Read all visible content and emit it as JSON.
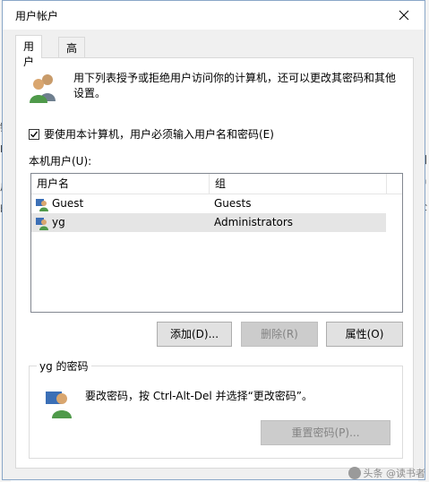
{
  "window": {
    "title": "用户帐户"
  },
  "tabs": [
    {
      "label": "用户",
      "active": true
    },
    {
      "label": "高级",
      "active": false
    }
  ],
  "intro": {
    "text": "用下列表授予或拒绝用户访问你的计算机，还可以更改其密码和其他设置。"
  },
  "checkbox": {
    "label": "要使用本计算机，用户必须输入用户名和密码(E)",
    "checked": true
  },
  "users_section": {
    "label": "本机用户(U):",
    "columns": [
      "用户名",
      "组"
    ],
    "rows": [
      {
        "name": "Guest",
        "group": "Guests",
        "selected": false
      },
      {
        "name": "yg",
        "group": "Administrators",
        "selected": true
      }
    ]
  },
  "buttons": {
    "add": "添加(D)...",
    "remove": "删除(R)",
    "properties": "属性(O)"
  },
  "password_group": {
    "title": "yg 的密码",
    "text": "要改密码，按 Ctrl-Alt-Del 并选择“更改密码”。",
    "reset_button": "重置密码(P)..."
  },
  "background": {
    "left_chars": [
      "键",
      "E",
      "户",
      "的"
    ],
    "right_chars": [
      "门",
      "户",
      "全"
    ]
  },
  "watermark": "头条 @读书者"
}
